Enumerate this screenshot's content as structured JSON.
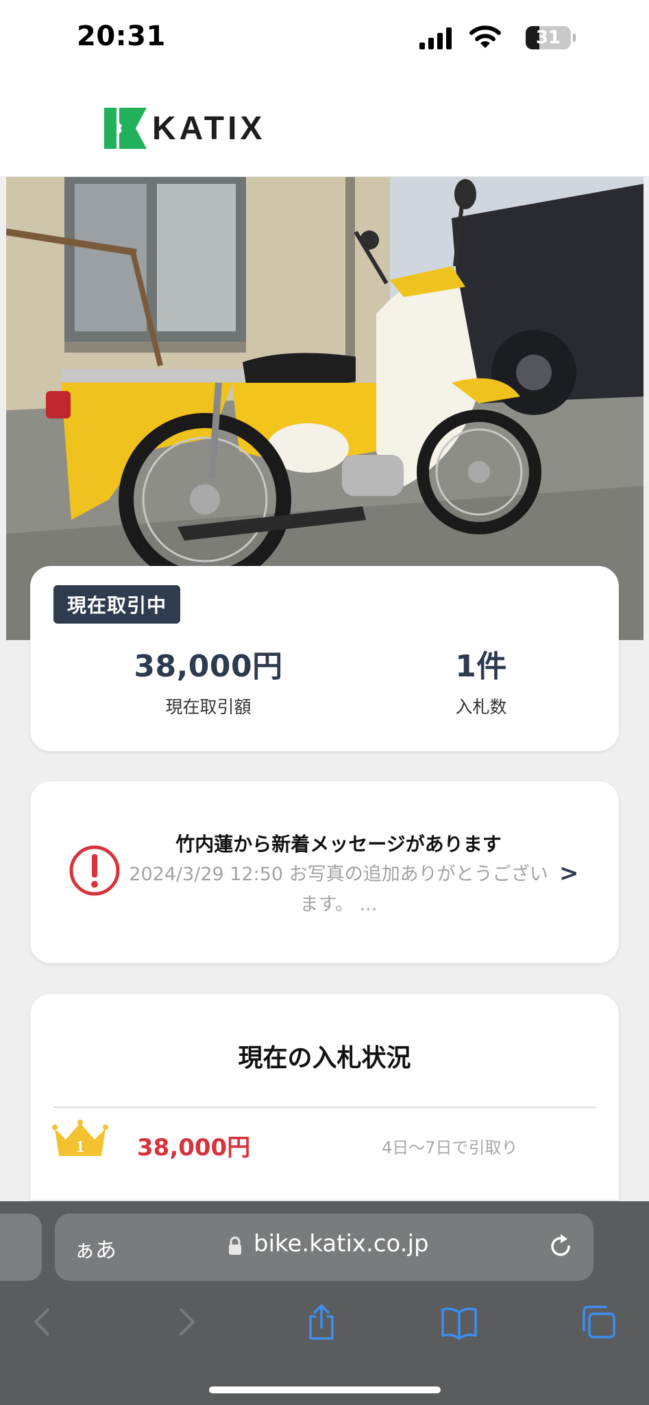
{
  "status_bar": {
    "time": "20:31",
    "battery_level": "31",
    "battery_fraction": 0.31,
    "icons": [
      "signal-icon",
      "wifi-icon",
      "battery-icon"
    ]
  },
  "header": {
    "logo_text": "KATIX",
    "brand_color": "#21b15a"
  },
  "listing": {
    "photo_subject": "yellow-scooter-photo",
    "status_badge": "現在取引中",
    "current_price": "38,000円",
    "current_price_label": "現在取引額",
    "bid_count": "1件",
    "bid_count_label": "入札数"
  },
  "message": {
    "title": "竹内蓮から新着メッセージがあります",
    "preview": "2024/3/29 12:50 お写真の追加ありがとうございます。 ...",
    "chevron": ">",
    "alert_color": "#d8323a"
  },
  "bids": {
    "title": "現在の入札状況",
    "entries": [
      {
        "rank": "1",
        "amount": "38,000円",
        "pickup": "4日〜7日で引取り"
      }
    ]
  },
  "browser": {
    "aa_label": "ぁあ",
    "url": "bike.katix.co.jp",
    "accent_color": "#3d8ff0",
    "toolbar": [
      "back-icon",
      "forward-icon",
      "share-icon",
      "bookmarks-icon",
      "tabs-icon"
    ]
  }
}
